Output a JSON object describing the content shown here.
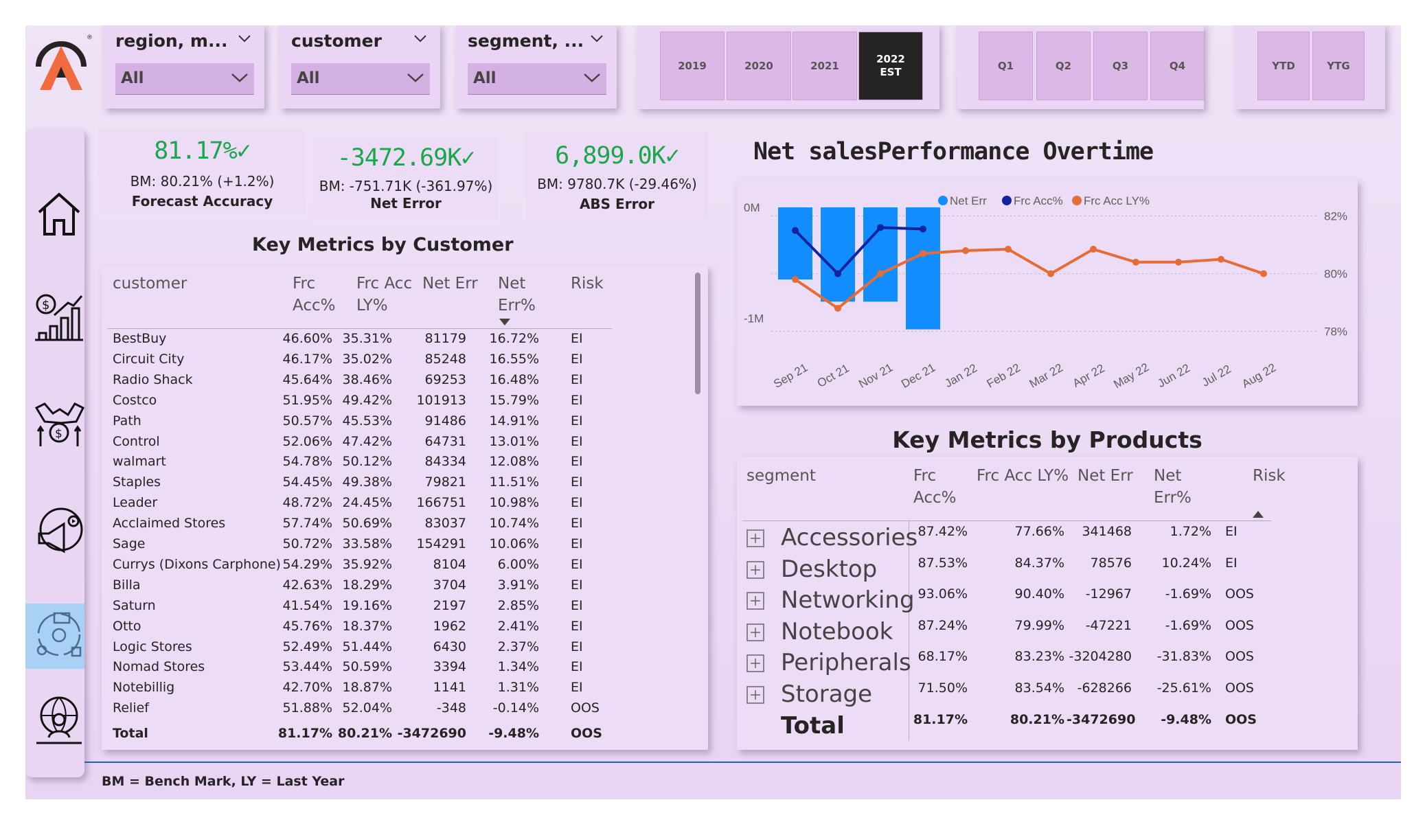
{
  "filters": [
    {
      "title": "region, m...",
      "value": "All"
    },
    {
      "title": "customer",
      "value": "All"
    },
    {
      "title": "segment, ...",
      "value": "All"
    }
  ],
  "years": [
    "2019",
    "2020",
    "2021",
    "2022",
    "EST"
  ],
  "quarters": [
    "Q1",
    "Q2",
    "Q3",
    "Q4"
  ],
  "period": [
    "YTD",
    "YTG"
  ],
  "kpis": [
    {
      "value": "81.17%",
      "bm": "BM: 80.21% (+1.2%)",
      "name": "Forecast Accuracy"
    },
    {
      "value": "-3472.69K",
      "bm": "BM: -751.71K (-361.97%)",
      "name": "Net Error"
    },
    {
      "value": "6,899.0K",
      "bm": "BM: 9780.7K (-29.46%)",
      "name": "ABS Error"
    }
  ],
  "customer_table": {
    "title": "Key Metrics by Customer",
    "headers": {
      "customer": "customer",
      "frc1": "Frc",
      "frc2": "Acc%",
      "ly1": "Frc Acc",
      "ly2": "LY%",
      "net": "Net Err",
      "nep1": "Net",
      "nep2": "Err%",
      "risk": "Risk"
    },
    "rows": [
      [
        "BestBuy",
        "46.60%",
        "35.31%",
        "81179",
        "16.72%",
        "EI"
      ],
      [
        "Circuit City",
        "46.17%",
        "35.02%",
        "85248",
        "16.55%",
        "EI"
      ],
      [
        "Radio Shack",
        "45.64%",
        "38.46%",
        "69253",
        "16.48%",
        "EI"
      ],
      [
        "Costco",
        "51.95%",
        "49.42%",
        "101913",
        "15.79%",
        "EI"
      ],
      [
        "Path",
        "50.57%",
        "45.53%",
        "91486",
        "14.91%",
        "EI"
      ],
      [
        "Control",
        "52.06%",
        "47.42%",
        "64731",
        "13.01%",
        "EI"
      ],
      [
        "walmart",
        "54.78%",
        "50.12%",
        "84334",
        "12.08%",
        "EI"
      ],
      [
        "Staples",
        "54.45%",
        "49.38%",
        "79821",
        "11.51%",
        "EI"
      ],
      [
        "Leader",
        "48.72%",
        "24.45%",
        "166751",
        "10.98%",
        "EI"
      ],
      [
        "Acclaimed Stores",
        "57.74%",
        "50.69%",
        "83037",
        "10.74%",
        "EI"
      ],
      [
        "Sage",
        "50.72%",
        "33.58%",
        "154291",
        "10.06%",
        "EI"
      ],
      [
        "Currys (Dixons Carphone)",
        "54.29%",
        "35.92%",
        "8104",
        "6.00%",
        "EI"
      ],
      [
        "Billa",
        "42.63%",
        "18.29%",
        "3704",
        "3.91%",
        "EI"
      ],
      [
        "Saturn",
        "41.54%",
        "19.16%",
        "2197",
        "2.85%",
        "EI"
      ],
      [
        "Otto",
        "45.76%",
        "18.37%",
        "1962",
        "2.41%",
        "EI"
      ],
      [
        "Logic Stores",
        "52.49%",
        "51.44%",
        "6430",
        "2.37%",
        "EI"
      ],
      [
        "Nomad Stores",
        "53.44%",
        "50.59%",
        "3394",
        "1.34%",
        "EI"
      ],
      [
        "Notebillig",
        "42.70%",
        "18.87%",
        "1141",
        "1.31%",
        "EI"
      ],
      [
        "Relief",
        "51.88%",
        "52.04%",
        "-348",
        "-0.14%",
        "OOS"
      ]
    ],
    "total": [
      "Total",
      "81.17%",
      "80.21%",
      "-3472690",
      "-9.48%",
      "OOS"
    ]
  },
  "chart": {
    "title": "Net salesPerformance Overtime"
  },
  "chart_data": {
    "type": "bar",
    "categories": [
      "Sep 21",
      "Oct 21",
      "Nov 21",
      "Dec 21",
      "Jan 22",
      "Feb 22",
      "Mar 22",
      "Apr 22",
      "May 22",
      "Jun 22",
      "Jul 22",
      "Aug 22"
    ],
    "series": [
      {
        "name": "Net Err",
        "type": "bar",
        "axis": "left",
        "color": "#118dff",
        "values": [
          -0.65,
          -0.85,
          -0.85,
          -1.1,
          null,
          null,
          null,
          null,
          null,
          null,
          null,
          null
        ]
      },
      {
        "name": "Frc Acc%",
        "type": "line",
        "axis": "right",
        "color": "#12239e",
        "values": [
          81.5,
          80,
          81.6,
          81.55,
          null,
          null,
          null,
          null,
          null,
          null,
          null,
          null
        ]
      },
      {
        "name": "Frc Acc LY%",
        "type": "line",
        "axis": "right",
        "color": "#e66c37",
        "values": [
          79.8,
          78.8,
          80,
          80.7,
          80.8,
          80.85,
          80,
          80.85,
          80.4,
          80.4,
          80.5,
          80
        ]
      }
    ],
    "left_axis": {
      "ticks": [
        "0M",
        "-1M"
      ],
      "range": [
        -1.3,
        0
      ]
    },
    "right_axis": {
      "ticks": [
        "82%",
        "80%",
        "78%"
      ],
      "range": [
        77.3,
        82.3
      ]
    },
    "legend": "top-center",
    "grid": true
  },
  "product_table": {
    "title": "Key Metrics by Products",
    "headers": {
      "segment": "segment",
      "frc1": "Frc",
      "frc2": "Acc%",
      "ly": "Frc Acc LY%",
      "net": "Net Err",
      "nep1": "Net",
      "nep2": "Err%",
      "risk": "Risk"
    },
    "rows": [
      [
        "Accessories",
        "87.42%",
        "77.66%",
        "341468",
        "1.72%",
        "EI"
      ],
      [
        "Desktop",
        "87.53%",
        "84.37%",
        "78576",
        "10.24%",
        "EI"
      ],
      [
        "Networking",
        "93.06%",
        "90.40%",
        "-12967",
        "-1.69%",
        "OOS"
      ],
      [
        "Notebook",
        "87.24%",
        "79.99%",
        "-47221",
        "-1.69%",
        "OOS"
      ],
      [
        "Peripherals",
        "68.17%",
        "83.23%",
        "-3204280",
        "-31.83%",
        "OOS"
      ],
      [
        "Storage",
        "71.50%",
        "83.54%",
        "-628266",
        "-25.61%",
        "OOS"
      ]
    ],
    "total": [
      "Total",
      "81.17%",
      "80.21%",
      "-3472690",
      "-9.48%",
      "OOS"
    ]
  },
  "footnote": "BM = Bench Mark, LY = Last Year",
  "nav": [
    "home-icon",
    "sales-growth-icon",
    "handshake-finance-icon",
    "marketing-icon",
    "supply-chain-settings-icon",
    "global-user-icon"
  ]
}
